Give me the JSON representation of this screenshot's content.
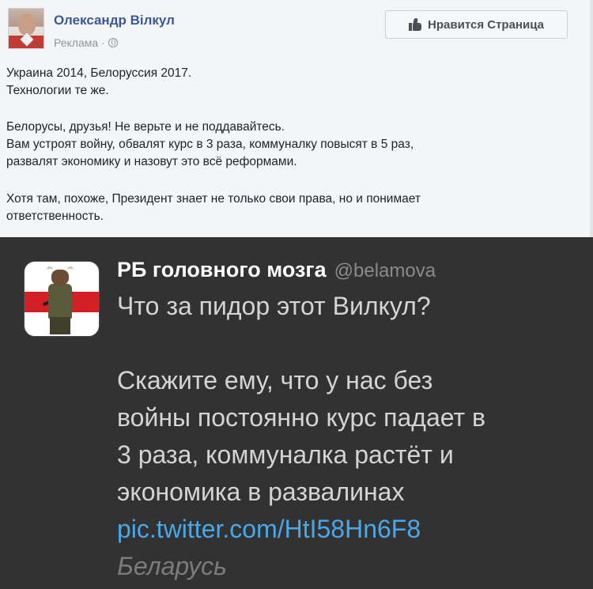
{
  "facebook_post": {
    "author_name": "Олександр Вілкул",
    "sponsored_label": "Реклама",
    "meta_separator": "·",
    "like_page_button": "Нравится Страница",
    "paragraph_1_line_1": "Украина 2014, Белоруссия 2017.",
    "paragraph_1_line_2": "Технологии те же.",
    "paragraph_2_line_1": "Белорусы, друзья! Не верьте и не поддавайтесь.",
    "paragraph_2_line_2": "Вам устроят войну, обвалят курс в 3 раза, коммуналку повысят в 5 раз,",
    "paragraph_2_line_3": "развалят экономику и назовут это всё реформами.",
    "paragraph_3_line_1": "Хотя там, похоже, Президент знает не только свои права, но и понимает",
    "paragraph_3_line_2": "ответственность."
  },
  "tweet": {
    "display_name": "РБ головного мозга",
    "handle": "@belamova",
    "line_1": "Что за пидор этот Вилкул?",
    "line_2": "Скажите ему, что у нас без",
    "line_3": "войны постоянно курс падает в",
    "line_4": "3 раза, коммуналка растёт и",
    "line_5": "экономика в развалинах",
    "link": "pic.twitter.com/HtI58Hn6F8",
    "location": "Беларусь"
  },
  "colors": {
    "fb_name_blue": "#3b5998",
    "fb_background": "#f4f5f7",
    "tweet_background": "#323232",
    "tweet_link_blue": "#4aa8e8"
  },
  "icons": [
    "globe-icon",
    "thumbs-up-icon"
  ]
}
